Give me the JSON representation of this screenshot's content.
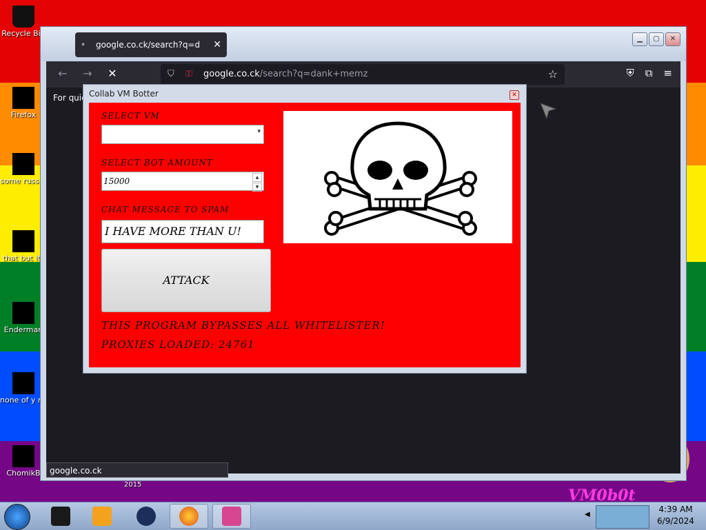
{
  "desktop": {
    "colors": [
      "#e40303",
      "#ff8c00",
      "#ffed00",
      "#008026",
      "#004dff",
      "#750787"
    ],
    "icons": [
      {
        "label": "Recycle Bin",
        "icon": "recycle-bin-icon"
      },
      {
        "label": "Firefox",
        "icon": "firefox-icon"
      },
      {
        "label": "some russ ran a ra",
        "icon": "document-icon"
      },
      {
        "label": "that but its",
        "icon": "folder-icon"
      },
      {
        "label": "Enderman",
        "icon": "terminal-icon"
      },
      {
        "label": "none of y retards kn",
        "icon": "app-icon"
      },
      {
        "label": "ChomikB",
        "icon": "hamster-icon"
      }
    ],
    "year_text": "2015",
    "watermark": "VM0b0t"
  },
  "browser": {
    "tab_title": "google.co.ck/search?q=dank+m",
    "url_host": "google.co.ck",
    "url_path": "/search?q=dank+memz",
    "quick_text": "For quic",
    "status_url": "google.co.ck",
    "icons": {
      "back": "←",
      "forward": "→",
      "stop": "✕",
      "lock": "⛉",
      "permissions": "⚿",
      "star": "☆",
      "pocket": "⛨",
      "extensions": "⧉",
      "menu": "≡"
    },
    "window_buttons": {
      "minimize": "▁",
      "maximize": "▢",
      "close": "✕"
    }
  },
  "dialog": {
    "title": "Collab VM Botter",
    "close_glyph": "✕",
    "select_vm_label": "SELECT VM",
    "select_vm_value": "",
    "bot_amount_label": "SELECT BOT AMOUNT",
    "bot_amount_value": "15000",
    "chat_label": "CHAT MESSAGE TO SPAM",
    "chat_value": "I HAVE MORE THAN U!",
    "attack_label": "ATTACK",
    "note1": "THIS PROGRAM BYPASSES ALL WHITELISTER!",
    "note2": "PROXIES LOADED: 24761",
    "accent_color": "#ff0000",
    "image_icon": "skull-crossbones-icon"
  },
  "taskbar": {
    "time": "4:39 AM",
    "date": "6/9/2024",
    "apps": [
      "cmd-icon",
      "media-player-icon",
      "browser-globe-icon",
      "firefox-icon",
      "paint-icon"
    ],
    "tray_arrow": "◀"
  }
}
